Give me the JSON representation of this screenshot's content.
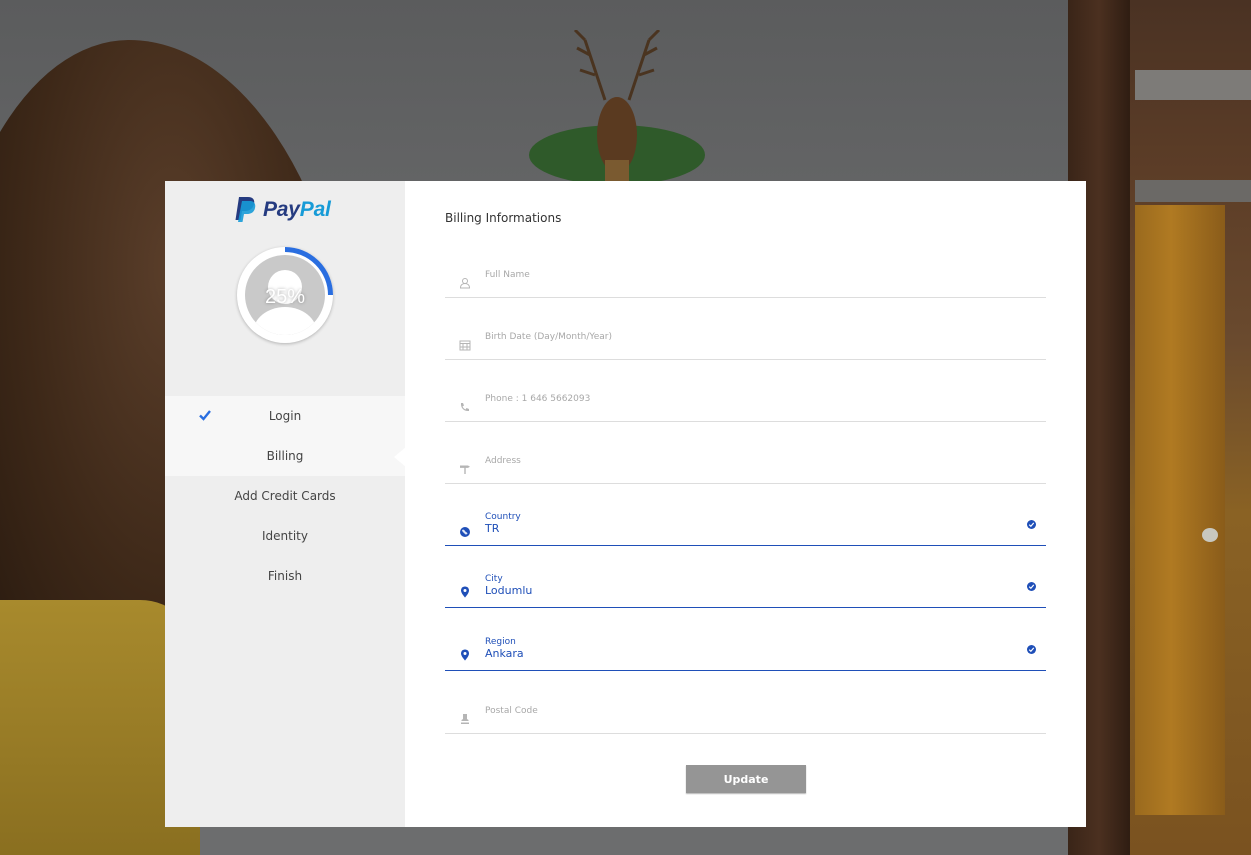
{
  "brand": {
    "pay": "Pay",
    "pal": "Pal"
  },
  "progress": {
    "label": "25%",
    "value": 0.25
  },
  "steps": [
    {
      "label": "Login",
      "state": "done"
    },
    {
      "label": "Billing",
      "state": "active"
    },
    {
      "label": "Add Credit Cards",
      "state": "todo"
    },
    {
      "label": "Identity",
      "state": "todo"
    },
    {
      "label": "Finish",
      "state": "todo"
    }
  ],
  "form": {
    "title": "Billing Informations",
    "full_name": {
      "placeholder": "Full Name",
      "icon": "user-icon"
    },
    "birth_date": {
      "placeholder": "Birth Date (Day/Month/Year)",
      "icon": "calendar-icon"
    },
    "phone": {
      "placeholder": "Phone : 1 646 5662093",
      "icon": "phone-icon"
    },
    "address": {
      "placeholder": "Address",
      "icon": "signpost-icon"
    },
    "country": {
      "label": "Country",
      "value": "TR",
      "icon": "globe-icon"
    },
    "city": {
      "label": "City",
      "value": "Lodumlu",
      "icon": "map-pin-icon"
    },
    "region": {
      "label": "Region",
      "value": "Ankara",
      "icon": "map-pin-icon"
    },
    "postal_code": {
      "placeholder": "Postal Code",
      "icon": "postal-icon"
    },
    "update_label": "Update"
  },
  "colors": {
    "accent": "#1f4fb8",
    "sidebar_bg": "#eeeeee",
    "button_bg": "#959595",
    "paypal_dark": "#253b80",
    "paypal_light": "#179bd7",
    "progress_arc": "#2a6ee0"
  }
}
